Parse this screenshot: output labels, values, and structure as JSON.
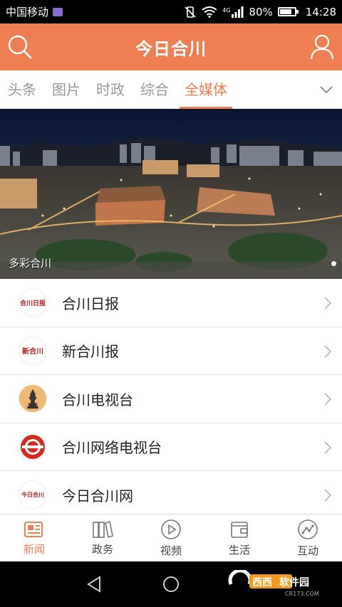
{
  "status": {
    "carrier": "中国移动",
    "network": "4G",
    "battery": "80%",
    "battery_level": 0.8,
    "time": "14:28"
  },
  "header": {
    "title": "今日合川"
  },
  "tabs": [
    {
      "label": "头条",
      "active": false
    },
    {
      "label": "图片",
      "active": false
    },
    {
      "label": "时政",
      "active": false
    },
    {
      "label": "综合",
      "active": false
    },
    {
      "label": "全媒体",
      "active": true
    }
  ],
  "banner": {
    "caption": "多彩合川"
  },
  "list": [
    {
      "label": "合川日报",
      "logo": "合川日报"
    },
    {
      "label": "新合川报",
      "logo": "新合川"
    },
    {
      "label": "合川电视台",
      "logo": "pagoda-logo"
    },
    {
      "label": "合川网络电视台",
      "logo": "network-tv-logo"
    },
    {
      "label": "今日合川网",
      "logo": "今日合川"
    }
  ],
  "bottom_nav": [
    {
      "label": "新闻",
      "icon": "news-icon",
      "active": true
    },
    {
      "label": "政务",
      "icon": "books-icon",
      "active": false
    },
    {
      "label": "视频",
      "icon": "play-icon",
      "active": false
    },
    {
      "label": "生活",
      "icon": "wallet-icon",
      "active": false
    },
    {
      "label": "互动",
      "icon": "chart-icon",
      "active": false
    }
  ],
  "watermark": {
    "text": "西西软件园",
    "sub": "CR173.COM"
  },
  "colors": {
    "accent": "#ef7f52",
    "inactive": "#999999"
  }
}
